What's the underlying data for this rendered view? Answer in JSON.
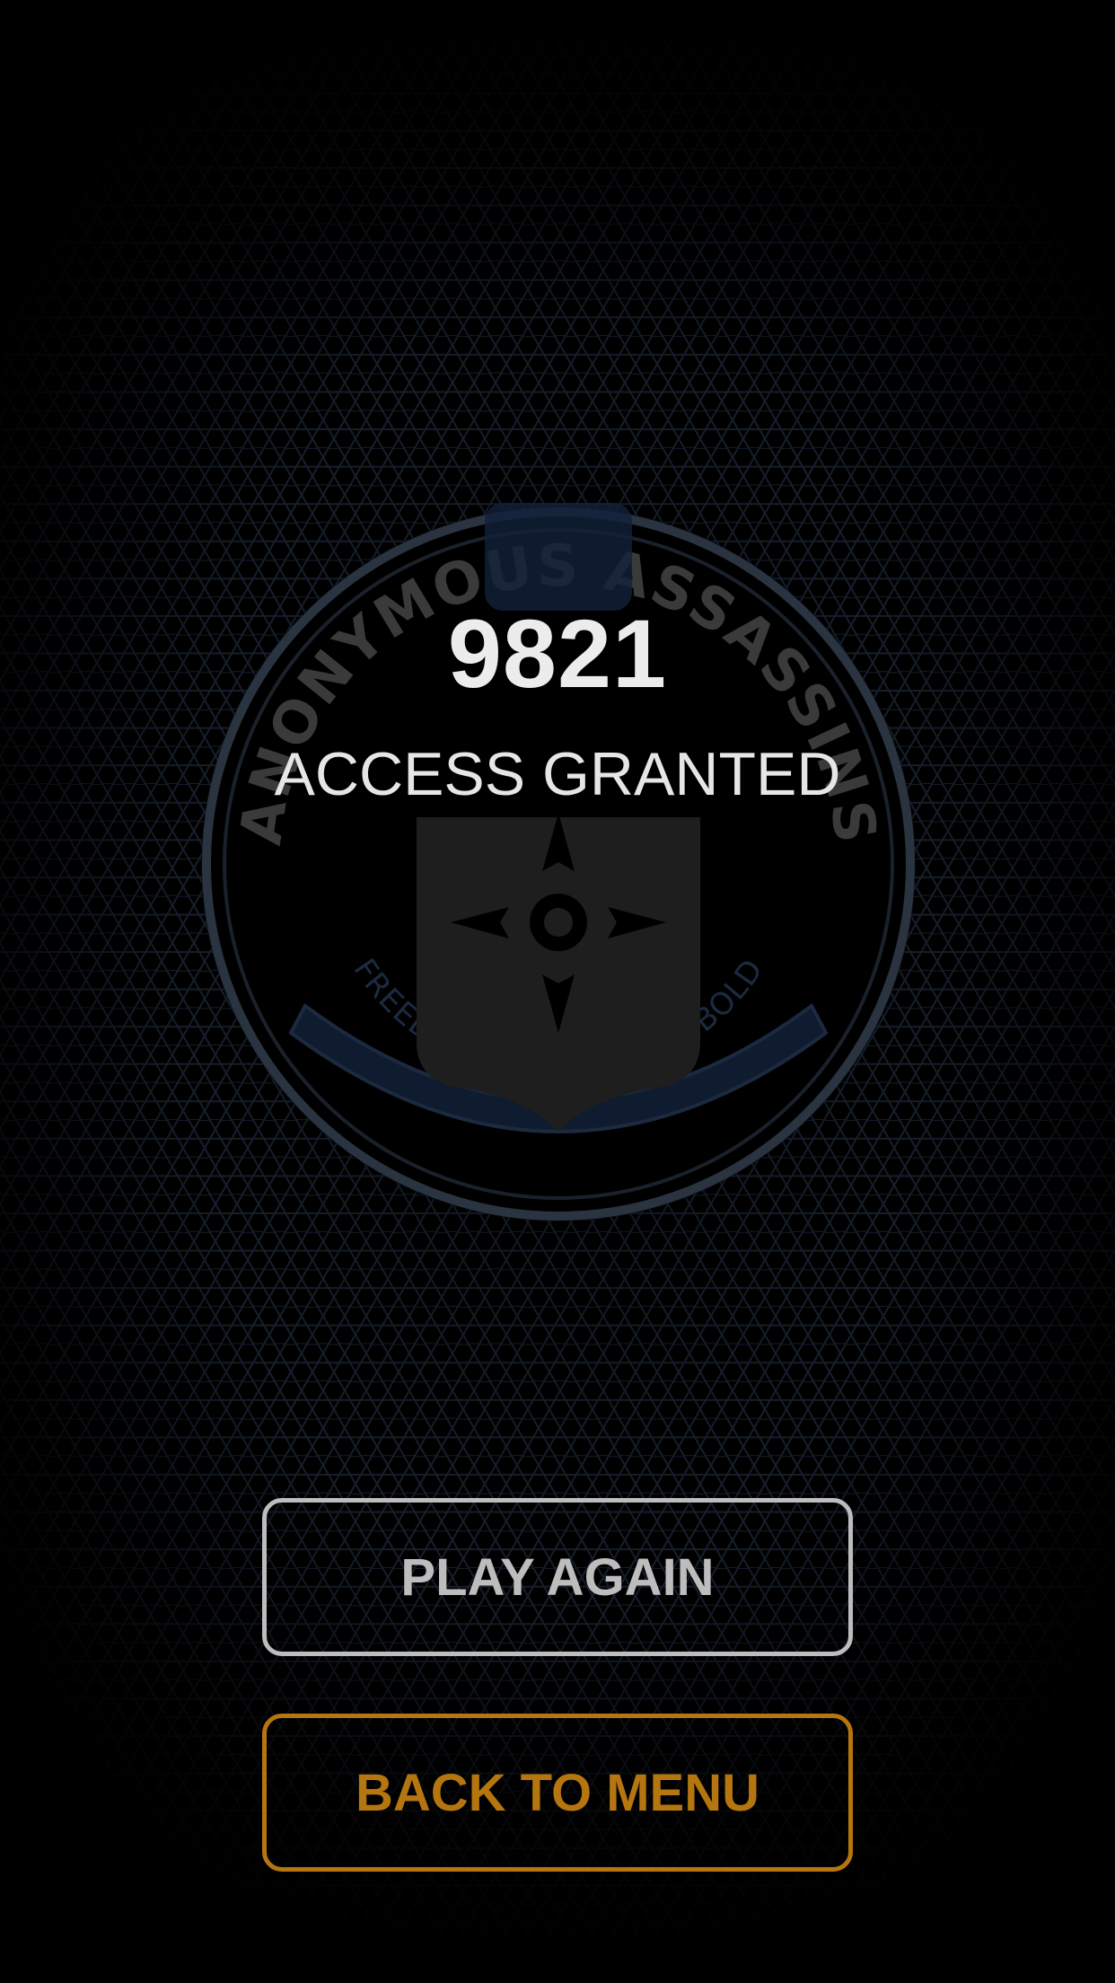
{
  "game": {
    "code": "9821",
    "status": "ACCESS GRANTED"
  },
  "emblem": {
    "top_text": "ANONYMOUS ASSASSINS",
    "motto": "FREEDOM LIES IN BEING BOLD"
  },
  "buttons": {
    "play_again": "PLAY AGAIN",
    "back_to_menu": "BACK TO MENU"
  },
  "colors": {
    "background": "#000000",
    "hex_pattern": "#1b2433",
    "play_again": "#bdbdbd",
    "back_to_menu": "#b5760f",
    "emblem_ring": "#2a3340",
    "ribbon": "#0f1b2e"
  }
}
